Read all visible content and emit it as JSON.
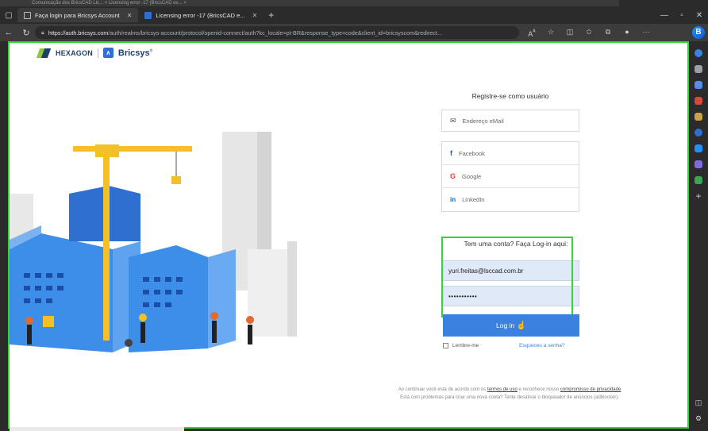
{
  "browser": {
    "ghost_tabs": "Comunicação dos BricsCAD Lic... ×   Licensing error -17 (BricsCAD ex... ×",
    "tabs": [
      {
        "label": "Faça login para Bricsys Account",
        "active": true
      },
      {
        "label": "Licensing error -17 (BricsCAD e...",
        "active": false
      }
    ],
    "url_domain": "https://auth.bricsys.com",
    "url_rest": "/auth/realms/bricsys-account/protocol/openid-connect/auth?kc_locale=pt-BR&response_type=code&client_id=bricsyscom&redirect...",
    "edge_icon": "B"
  },
  "brand": {
    "hexagon": "HEXAGON",
    "bricsys": "Bricsys",
    "bricsys_mark": "∧",
    "colors": {
      "hexagon_blue": "#1d3f6e",
      "hexagon_green": "#8cc63f",
      "bricsys_blue": "#2f6fd1"
    }
  },
  "register": {
    "title": "Registre-se como usuário",
    "email_label": "Endereço eMail",
    "socials": [
      {
        "icon": "f",
        "label": "Facebook"
      },
      {
        "icon": "G",
        "label": "Google"
      },
      {
        "icon": "in",
        "label": "LinkedIn"
      }
    ]
  },
  "login": {
    "heading": "Tem uma conta? Faça Log-in aqui:",
    "email_value": "yuri.freitas@lsccad.com.br",
    "password_value": "•••••••••••",
    "button_label": "Log in",
    "remember_label": "Lembre-me",
    "forgot_label": "Esqueceu a senha?",
    "accent_color": "#3b82e0",
    "highlight_color": "#34d534"
  },
  "footer": {
    "line1_prefix": "Ao continuar você está de acordo com os",
    "terms_link": "termos de uso",
    "line1_mid": "e reconhece nosso",
    "privacy_link": "compromisso de privacidade",
    "line2": "Está com problemas para criar uma nova conta? Tente desativar o bloqueador de anúncios (adblocker)."
  }
}
